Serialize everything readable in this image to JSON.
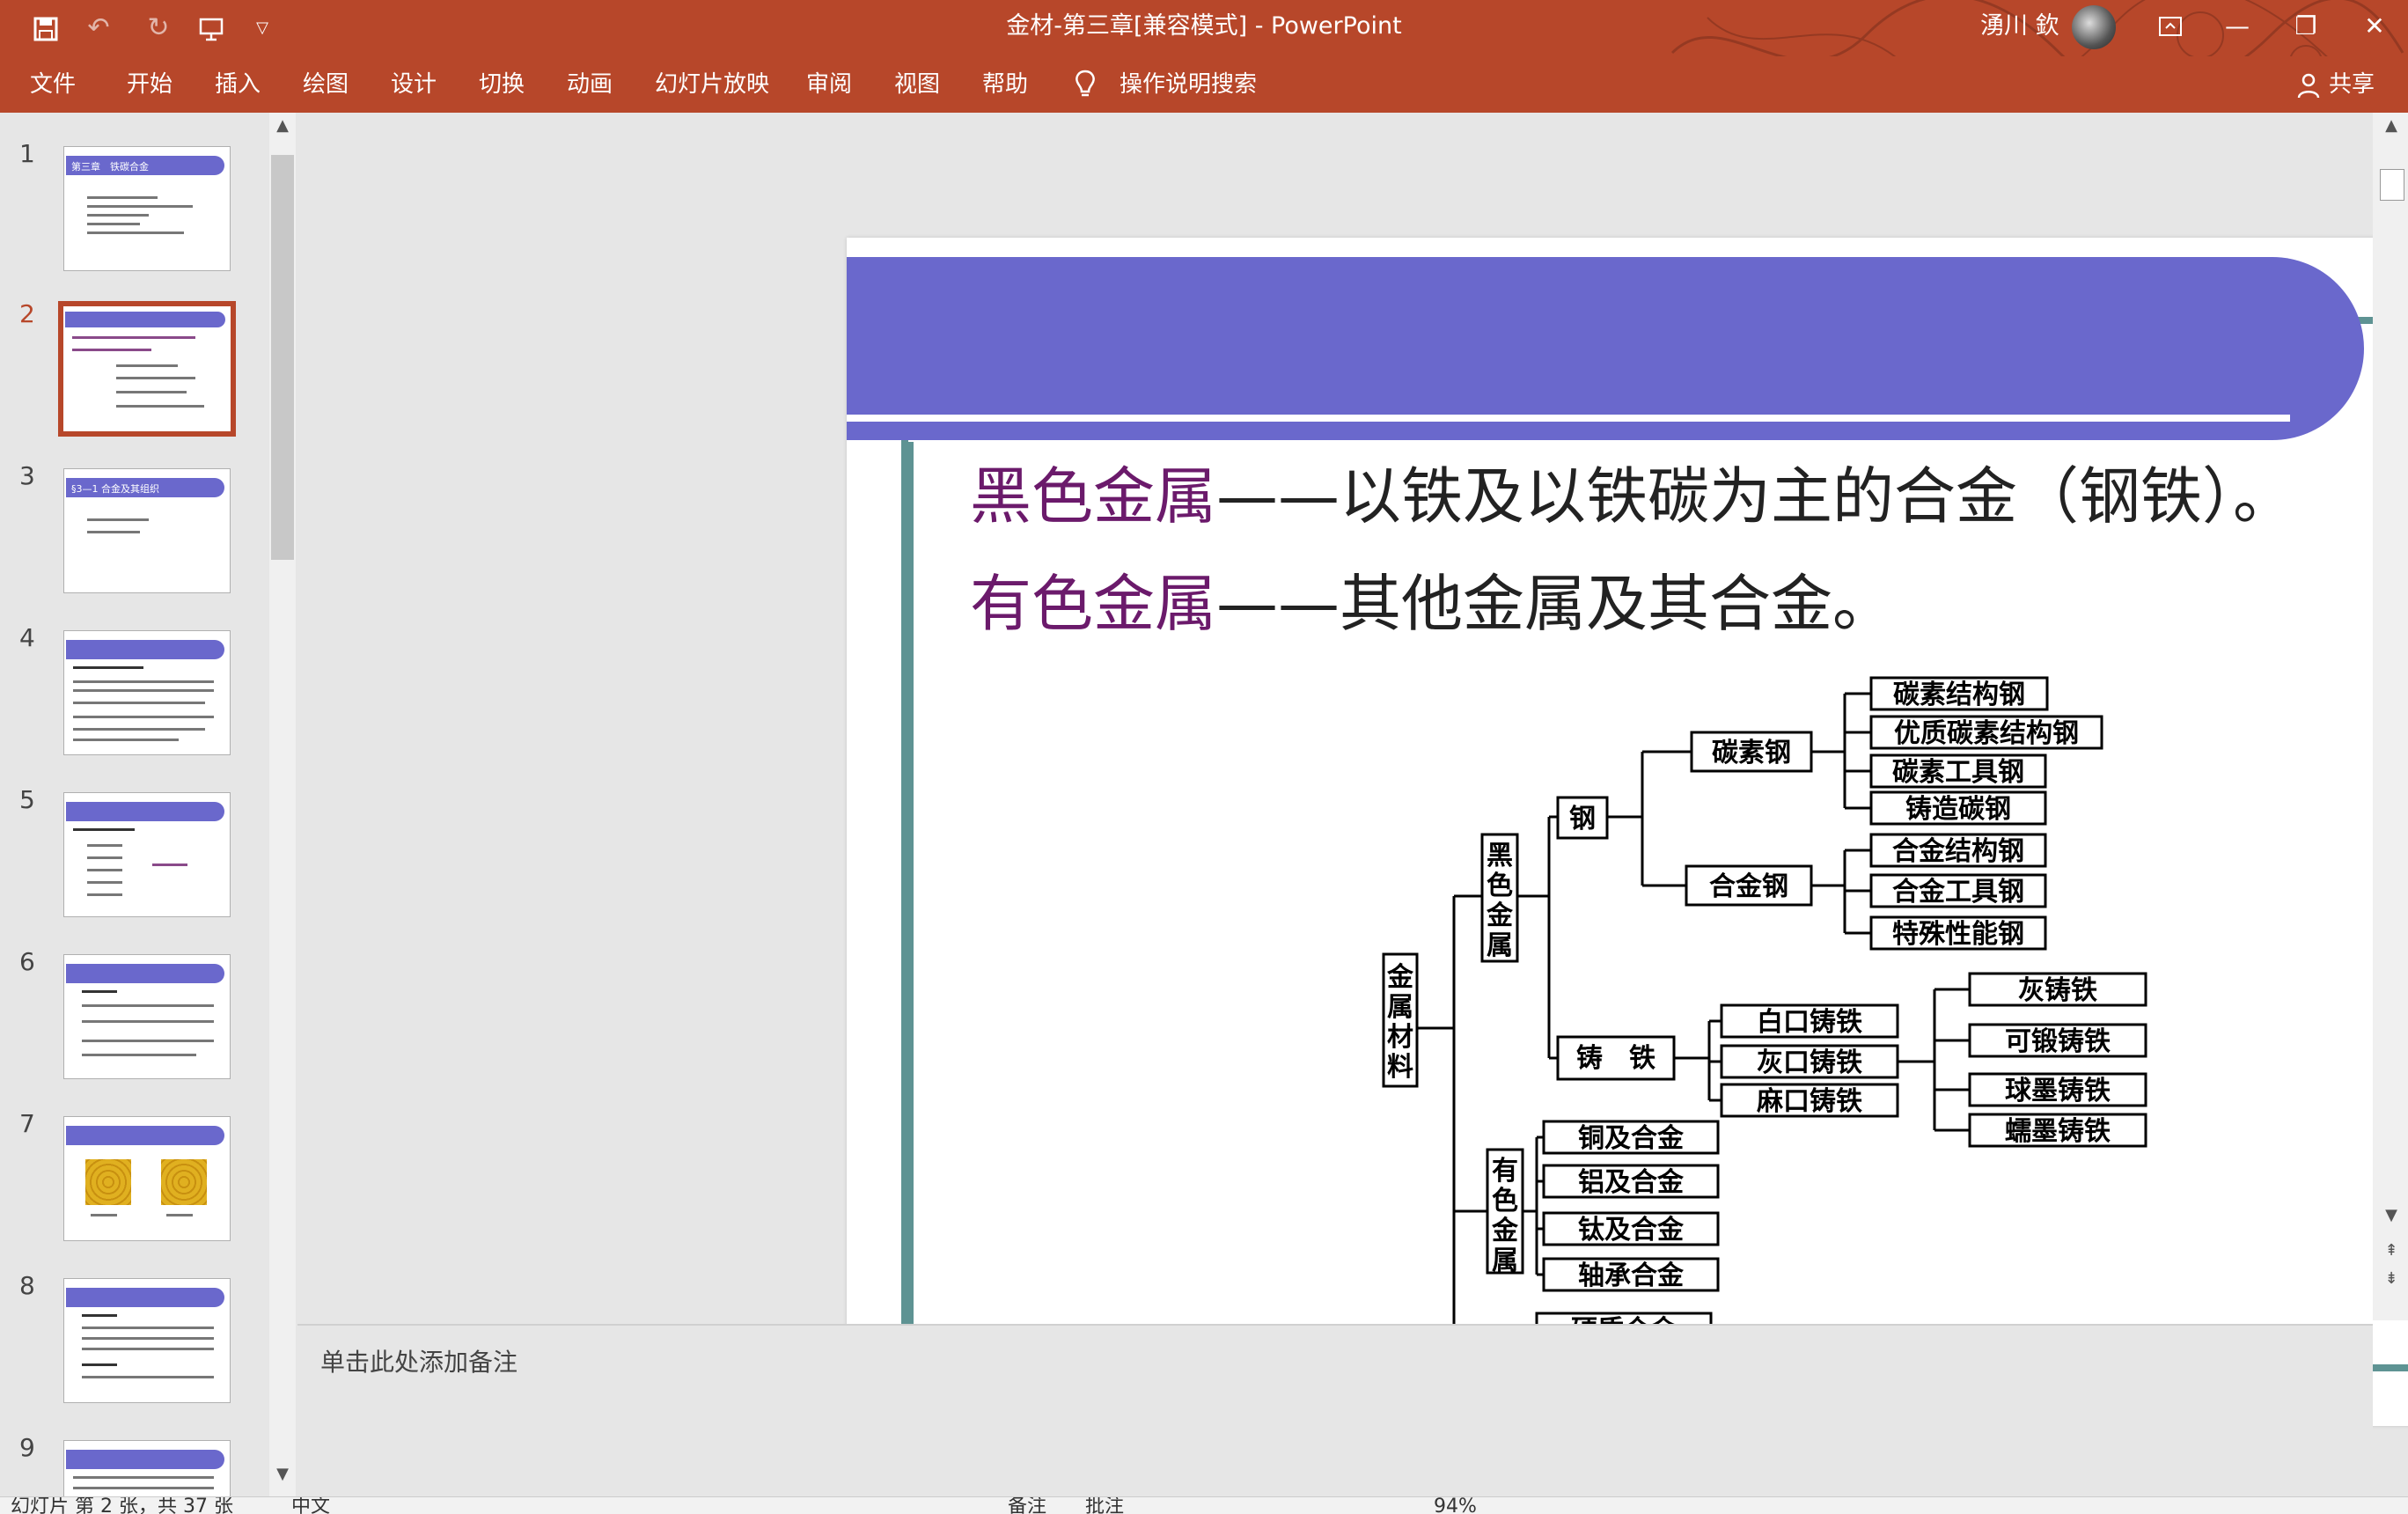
{
  "window": {
    "title": "金材-第三章[兼容模式]  -  PowerPoint",
    "user": "湧川 欽"
  },
  "quick_access": {
    "save_icon": "save-icon",
    "undo_icon": "undo-icon",
    "redo_icon": "redo-icon",
    "start_icon": "present-icon",
    "customize_icon": "chevron-down-icon"
  },
  "ribbon": {
    "tabs": [
      "文件",
      "开始",
      "插入",
      "绘图",
      "设计",
      "切换",
      "动画",
      "幻灯片放映",
      "审阅",
      "视图",
      "帮助"
    ],
    "search": "操作说明搜索",
    "share": "共享"
  },
  "thumbnails": {
    "numbers": [
      "1",
      "2",
      "3",
      "4",
      "5",
      "6",
      "7",
      "8",
      "9"
    ],
    "active_index": 2,
    "t1_title": "第三章　铁碳合金",
    "t3_title": "§3—1  合金及其组织"
  },
  "slide": {
    "heading_line1_term": "黑色金属",
    "heading_line1_rest": "——以铁及以铁碳为主的合金（钢铁）。",
    "heading_line2_term": "有色金属",
    "heading_line2_rest": "——其他金属及其合金。",
    "tree": {
      "root": "金属材料",
      "ferrous": "黑色金属",
      "nonferrous": "有色金属",
      "steel": "钢",
      "carbon_steel": "碳素钢",
      "alloy_steel": "合金钢",
      "carbon_steel_items": [
        "碳素结构钢",
        "优质碳素结构钢",
        "碳素工具钢",
        "铸造碳钢"
      ],
      "alloy_steel_items": [
        "合金结构钢",
        "合金工具钢",
        "特殊性能钢"
      ],
      "cast_iron": "铸　铁",
      "cast_iron_items": [
        "白口铸铁",
        "灰口铸铁",
        "麻口铸铁"
      ],
      "gray_iron_items": [
        "灰铸铁",
        "可锻铸铁",
        "球墨铸铁",
        "蠕墨铸铁"
      ],
      "nonferrous_items": [
        "铜及合金",
        "铝及合金",
        "钛及合金",
        "轴承合金"
      ],
      "hard_alloy": "硬质合金"
    }
  },
  "notes": {
    "placeholder": "单击此处添加备注"
  },
  "status": {
    "text": "幻灯片 第 2 张，共 37 张　　　中文　　　　　　　　　　　　　　　　　　　　　　　　　　　　　　　　　　　备注　　批注　　　　　　　　　　　　　　　　94%"
  },
  "colors": {
    "accent": "#b7472a",
    "slide_band": "#6a68cc",
    "frame": "#5e9393",
    "term": "#6b1a6b"
  }
}
